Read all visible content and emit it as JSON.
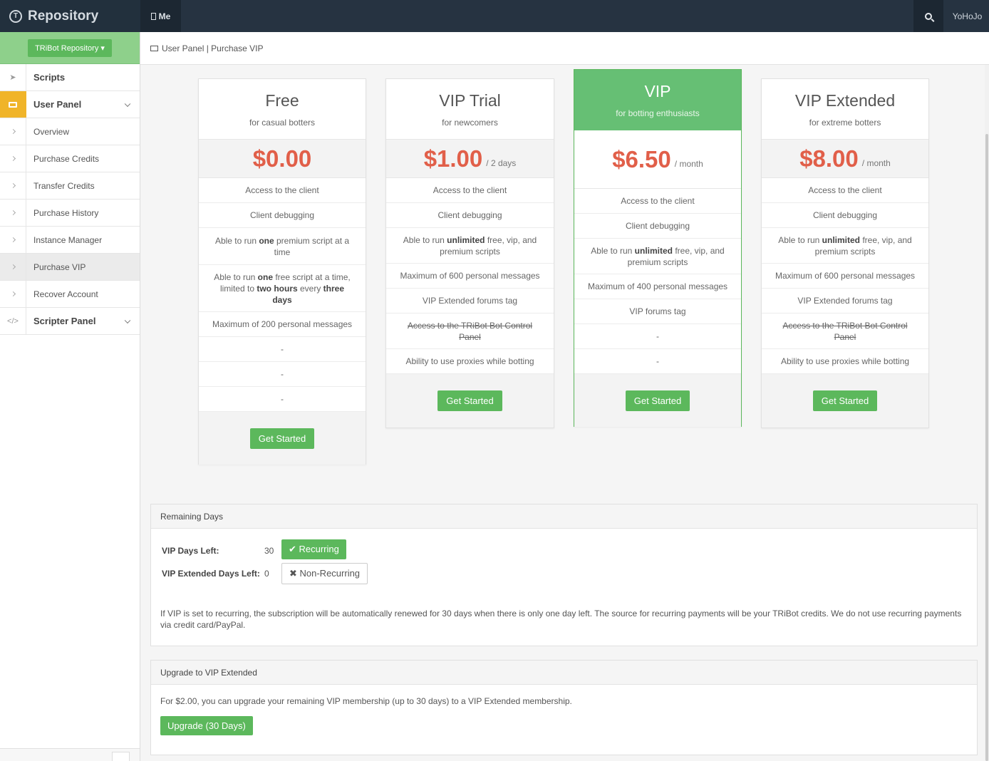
{
  "topbar": {
    "brand_logo": "T",
    "brand": "Repository",
    "tab_me": "Me",
    "user": "YoHoJo"
  },
  "sidebar": {
    "repo_button": "TRiBot Repository ▾",
    "scripts": "Scripts",
    "user_panel": "User Panel",
    "items": [
      "Overview",
      "Purchase Credits",
      "Transfer Credits",
      "Purchase History",
      "Instance Manager",
      "Purchase VIP",
      "Recover Account"
    ],
    "scripter_panel": "Scripter Panel"
  },
  "breadcrumb": "User Panel | Purchase VIP",
  "plans": {
    "free": {
      "name": "Free",
      "sub": "for casual botters",
      "price": "$0.00",
      "per": "",
      "f1": "Access to the client",
      "f2": "Client debugging",
      "f3a": "Able to run ",
      "f3b": "one",
      "f3c": " premium script at a time",
      "f4a": "Able to run ",
      "f4b": "one",
      "f4c": " free script at a time, limited to ",
      "f4d": "two hours",
      "f4e": " every ",
      "f4f": "three days",
      "f5": "Maximum of 200 personal messages",
      "f6": "-",
      "f7": "-",
      "f8": "-",
      "button": "Get Started"
    },
    "trial": {
      "name": "VIP Trial",
      "sub": "for newcomers",
      "price": "$1.00",
      "per": "/ 2 days",
      "f1": "Access to the client",
      "f2": "Client debugging",
      "f3a": "Able to run ",
      "f3b": "unlimited",
      "f3c": " free, vip, and premium scripts",
      "f4": "Maximum of 600 personal messages",
      "f5": "VIP Extended forums tag",
      "f6": "Access to the TRiBot Bot Control Panel",
      "f7": "Ability to use proxies while botting",
      "button": "Get Started"
    },
    "vip": {
      "name": "VIP",
      "sub": "for botting enthusiasts",
      "price": "$6.50",
      "per": "/ month",
      "f1": "Access to the client",
      "f2": "Client debugging",
      "f3a": "Able to run ",
      "f3b": "unlimited",
      "f3c": " free, vip, and premium scripts",
      "f4": "Maximum of 400 personal messages",
      "f5": "VIP forums tag",
      "f6": "-",
      "f7": "-",
      "button": "Get Started"
    },
    "extended": {
      "name": "VIP Extended",
      "sub": "for extreme botters",
      "price": "$8.00",
      "per": "/ month",
      "f1": "Access to the client",
      "f2": "Client debugging",
      "f3a": "Able to run ",
      "f3b": "unlimited",
      "f3c": " free, vip, and premium scripts",
      "f4": "Maximum of 600 personal messages",
      "f5": "VIP Extended forums tag",
      "f6": "Access to the TRiBot Bot Control Panel",
      "f7": "Ability to use proxies while botting",
      "button": "Get Started"
    }
  },
  "remaining": {
    "title": "Remaining Days",
    "vip_label": "VIP Days Left:",
    "vip_value": "30",
    "vip_toggle": "✔ Recurring",
    "ext_label": "VIP Extended Days Left:",
    "ext_value": "0",
    "ext_toggle": "✖ Non-Recurring",
    "note": "If VIP is set to recurring, the subscription will be automatically renewed for 30 days when there is only one day left. The source for recurring payments will be your TRiBot credits. We do not use recurring payments via credit card/PayPal."
  },
  "upgrade": {
    "title": "Upgrade to VIP Extended",
    "text": "For $2.00, you can upgrade your remaining VIP membership (up to 30 days) to a VIP Extended membership.",
    "button": "Upgrade (30 Days)"
  },
  "colors": {
    "accent": "#5cb85c",
    "price": "#e15f49",
    "topbar": "#263341",
    "active_icon": "#f0b429"
  }
}
